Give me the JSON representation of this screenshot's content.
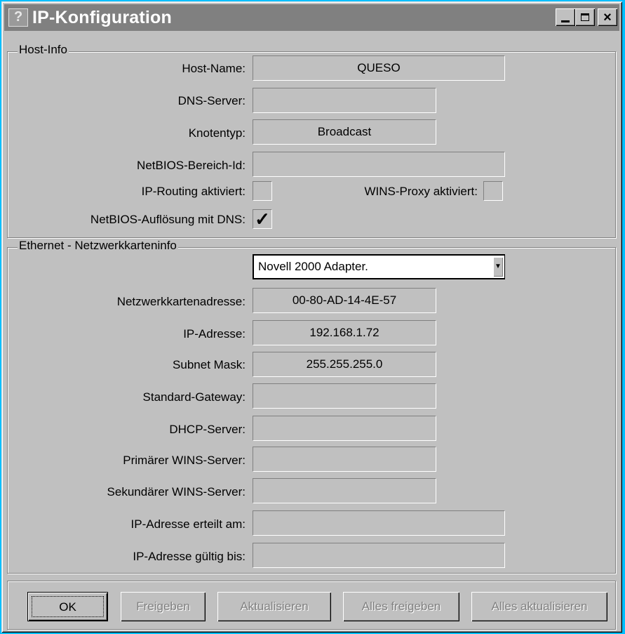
{
  "window": {
    "title": "IP-Konfiguration"
  },
  "host_info": {
    "group_label": "Host-Info",
    "host_name_label": "Host-Name:",
    "host_name": "QUESO",
    "dns_server_label": "DNS-Server:",
    "dns_server": "",
    "node_type_label": "Knotentyp:",
    "node_type": "Broadcast",
    "netbios_scope_label": "NetBIOS-Bereich-Id:",
    "netbios_scope": "",
    "ip_routing_label": "IP-Routing aktiviert:",
    "ip_routing_checked": false,
    "wins_proxy_label": "WINS-Proxy aktiviert:",
    "wins_proxy_checked": false,
    "netbios_dns_label": "NetBIOS-Auflösung mit DNS:",
    "netbios_dns_checked": true
  },
  "ethernet": {
    "group_label": "Ethernet - Netzwerkkarteninfo",
    "adapter_selected": "Novell 2000 Adapter.",
    "adapter_address_label": "Netzwerkkartenadresse:",
    "adapter_address": "00-80-AD-14-4E-57",
    "ip_label": "IP-Adresse:",
    "ip": "192.168.1.72",
    "subnet_label": "Subnet Mask:",
    "subnet": "255.255.255.0",
    "gateway_label": "Standard-Gateway:",
    "gateway": "",
    "dhcp_label": "DHCP-Server:",
    "dhcp": "",
    "wins_primary_label": "Primärer WINS-Server:",
    "wins_primary": "",
    "wins_secondary_label": "Sekundärer WINS-Server:",
    "wins_secondary": "",
    "lease_obtained_label": "IP-Adresse erteilt am:",
    "lease_obtained": "",
    "lease_expires_label": "IP-Adresse gültig bis:",
    "lease_expires": ""
  },
  "buttons": {
    "ok": "OK",
    "release": "Freigeben",
    "renew": "Aktualisieren",
    "release_all": "Alles freigeben",
    "renew_all": "Alles aktualisieren"
  },
  "checkmark_glyph": "✓"
}
